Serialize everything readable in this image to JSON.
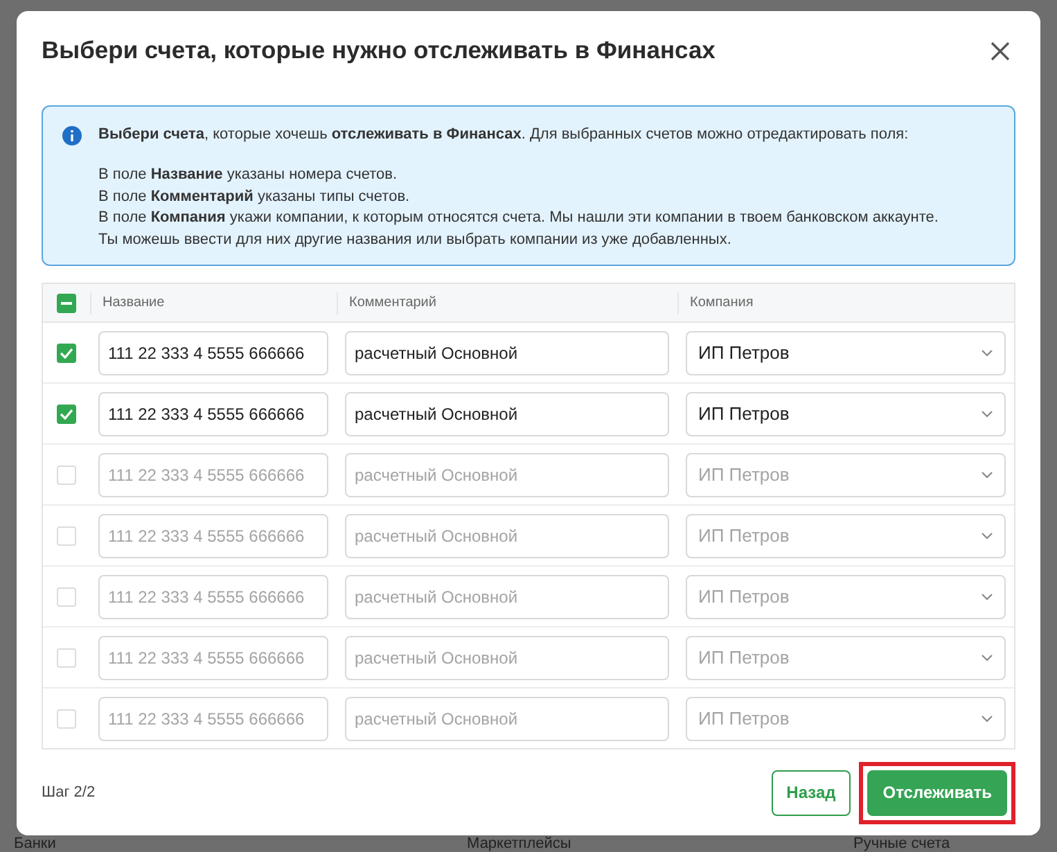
{
  "dialog": {
    "title": "Выбери счета, которые нужно отслеживать в Финансах"
  },
  "info": {
    "lead": "**Выбери счета**, которые хочешь **отслеживать в Финансах**. Для выбранных счетов можно отредактировать поля:",
    "lines": [
      "В поле **Название** указаны номера счетов.",
      "В поле **Комментарий** указаны типы счетов.",
      "В поле **Компания** укажи компании, к которым относятся счета. Мы нашли эти компании в твоем банковском аккаунте.",
      "Ты можешь ввести для них другие названия или выбрать компании из уже добавленных."
    ]
  },
  "table": {
    "select_all": {
      "checked": true,
      "partial": true
    },
    "columns": [
      "Название",
      "Комментарий",
      "Компания"
    ],
    "rows": [
      {
        "checked": true,
        "name": "111 22 333 4 5555 666666",
        "comment": "расчетный Основной",
        "company": "ИП Петров"
      },
      {
        "checked": true,
        "name": "111 22 333 4 5555 666666",
        "comment": "расчетный Основной",
        "company": "ИП Петров"
      },
      {
        "checked": false,
        "name": "111 22 333 4 5555 666666",
        "comment": "расчетный Основной",
        "company": "ИП Петров"
      },
      {
        "checked": false,
        "name": "111 22 333 4 5555 666666",
        "comment": "расчетный Основной",
        "company": "ИП Петров"
      },
      {
        "checked": false,
        "name": "111 22 333 4 5555 666666",
        "comment": "расчетный Основной",
        "company": "ИП Петров"
      },
      {
        "checked": false,
        "name": "111 22 333 4 5555 666666",
        "comment": "расчетный Основной",
        "company": "ИП Петров"
      },
      {
        "checked": false,
        "name": "111 22 333 4 5555 666666",
        "comment": "расчетный Основной",
        "company": "ИП Петров"
      }
    ]
  },
  "footer": {
    "step": "Шаг 2/2",
    "buttons": [
      {
        "label": "Назад",
        "kind": "secondary"
      },
      {
        "label": "Отслеживать",
        "kind": "primary",
        "highlighted": true
      }
    ]
  },
  "background": {
    "tabs": [
      "Банки",
      "Маркетплейсы",
      "Ручные счета"
    ]
  }
}
